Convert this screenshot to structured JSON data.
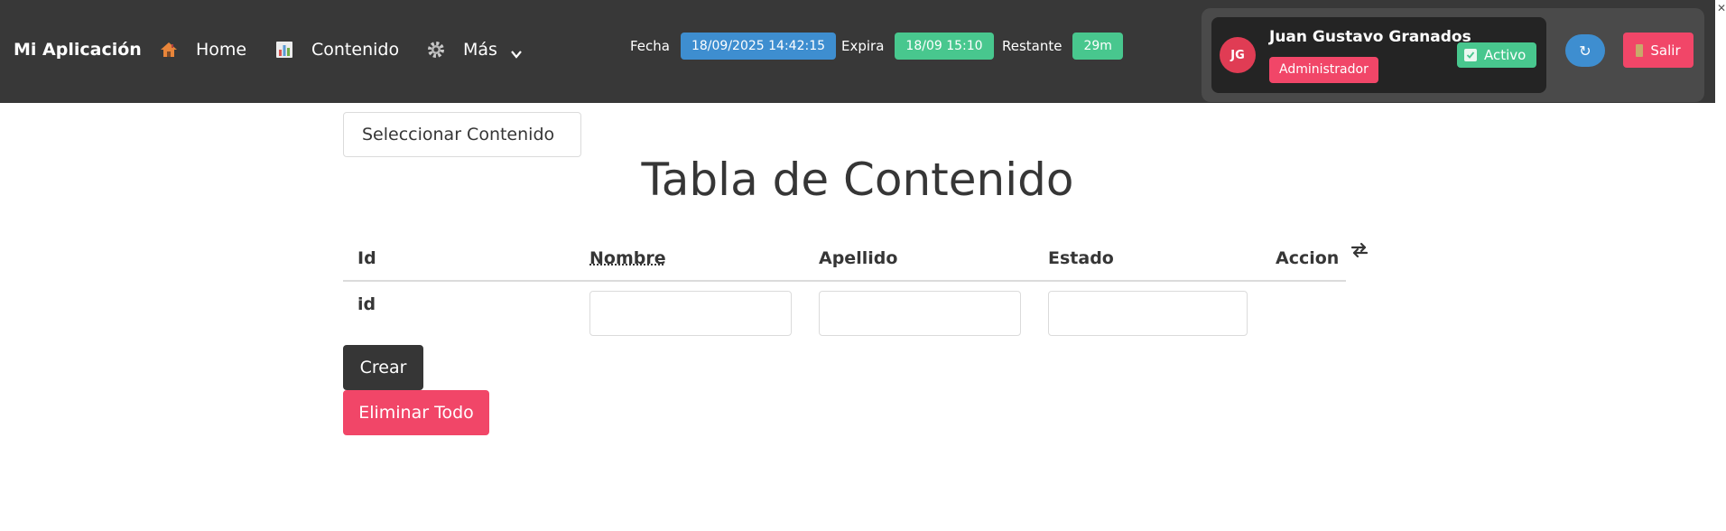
{
  "navbar": {
    "brand": "Mi Aplicación",
    "items": [
      {
        "label": "Home",
        "icon": "house-icon"
      },
      {
        "label": "Contenido",
        "icon": "bar-chart-icon"
      },
      {
        "label": "Más",
        "icon": "gear-icon"
      }
    ],
    "meta": {
      "fecha_label": "Fecha",
      "fecha_value": "18/09/2025 14:42:15",
      "expira_label": "Expira",
      "expira_value": "18/09 15:10",
      "restante_label": "Restante",
      "restante_value": "29m"
    },
    "user": {
      "initials": "JG",
      "name": "Juan Gustavo Granados",
      "role": "Administrador",
      "status": "Activo",
      "refresh": "↻",
      "logout": "Salir"
    }
  },
  "main": {
    "select_label": "Seleccionar Contenido",
    "title": "Tabla de Contenido",
    "table": {
      "headers": [
        "Id",
        "Nombre",
        "Apellido",
        "Estado",
        "Accion"
      ],
      "new_row": {
        "id": "id",
        "nombre": "",
        "apellido": "",
        "estado": ""
      }
    },
    "buttons": {
      "crear": "Crear",
      "eliminar_todo": "Eliminar Todo"
    }
  },
  "colors": {
    "navbar_bg": "#383838",
    "blue": "#3e8ed0",
    "green": "#48c78e",
    "danger": "#f14668",
    "dark_button": "#363636"
  }
}
